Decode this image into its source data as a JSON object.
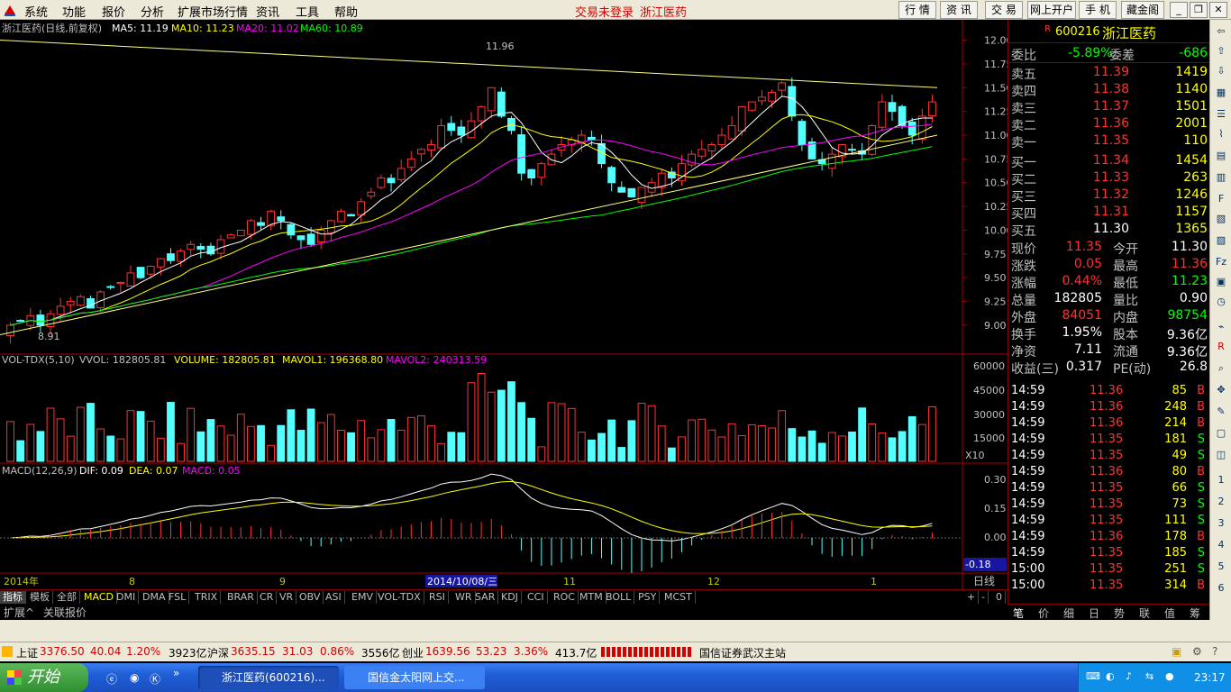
{
  "menu": {
    "items": [
      "系统",
      "功能",
      "报价",
      "分析",
      "扩展市场行情",
      "资讯",
      "工具",
      "帮助"
    ],
    "notice1": "交易未登录",
    "notice2": "浙江医药",
    "right": [
      "行 情",
      "资 讯",
      "交 易",
      "网上开户",
      "手 机",
      "藏金阁"
    ]
  },
  "chart": {
    "title": "浙江医药(日线,前复权)",
    "ma5": "MA5: 11.19",
    "ma10": "MA10: 11.23",
    "ma20": "MA20: 11.02",
    "ma60": "MA60: 10.89",
    "high_mark": "11.96",
    "low_mark": "8.91",
    "price_ticks": [
      "12.00",
      "11.75",
      "11.50",
      "11.25",
      "11.00",
      "10.75",
      "10.50",
      "10.25",
      "10.00",
      "9.75",
      "9.50",
      "9.25",
      "9.00"
    ],
    "vol_title": "VOL-TDX(5,10)",
    "vvol": "VVOL: 182805.81",
    "volume": "VOLUME: 182805.81",
    "mavol1": "MAVOL1: 196368.80",
    "mavol2": "MAVOL2: 240313.59",
    "vol_ticks": [
      "60000",
      "45000",
      "30000",
      "15000"
    ],
    "vol_unit": "X10",
    "macd_title": "MACD(12,26,9)",
    "dif": "DIF: 0.09",
    "dea": "DEA: 0.07",
    "macd": "MACD: 0.05",
    "macd_ticks": [
      "0.30",
      "0.15",
      "0.00"
    ],
    "macd_cursor": "-0.18",
    "date_labels": [
      "2014年",
      "8",
      "9",
      "2014/10/08/三",
      "11",
      "12",
      "1"
    ],
    "period": "日线"
  },
  "chart_data": {
    "type": "candlestick",
    "series_colors": {
      "up": "#ff3232",
      "down": "#54ffff",
      "ma5": "#ffffff",
      "ma10": "#ffff00",
      "ma20": "#ff00ff",
      "ma60": "#00ff00"
    },
    "price_range": [
      8.91,
      11.96
    ],
    "ylim": [
      8.8,
      12.1
    ],
    "closes": [
      9.0,
      9.05,
      9.1,
      9.0,
      9.12,
      9.2,
      9.25,
      9.3,
      9.18,
      9.35,
      9.4,
      9.45,
      9.55,
      9.5,
      9.62,
      9.7,
      9.68,
      9.78,
      9.85,
      9.8,
      9.75,
      9.9,
      9.95,
      10.0,
      10.1,
      10.05,
      10.2,
      10.1,
      9.95,
      9.9,
      9.85,
      10.0,
      10.1,
      10.2,
      10.15,
      10.3,
      10.4,
      10.55,
      10.5,
      10.65,
      10.75,
      10.85,
      10.9,
      11.1,
      11.05,
      11.0,
      11.15,
      11.3,
      11.5,
      11.2,
      11.05,
      10.6,
      10.55,
      10.7,
      10.8,
      10.9,
      10.95,
      11.0,
      10.95,
      10.7,
      10.5,
      10.4,
      10.35,
      10.45,
      10.5,
      10.6,
      10.55,
      10.7,
      10.8,
      10.85,
      10.9,
      11.0,
      11.1,
      11.3,
      11.35,
      11.4,
      11.45,
      11.55,
      11.2,
      10.9,
      10.75,
      10.7,
      10.8,
      10.9,
      10.85,
      10.8,
      11.1,
      11.35,
      11.25,
      11.1,
      11.0,
      11.2,
      11.35
    ],
    "vol_range": [
      0,
      60000
    ],
    "macd_range": [
      -0.25,
      0.35
    ]
  },
  "quote": {
    "market": "R",
    "code": "600216",
    "name": "浙江医药",
    "wei_bi_label": "委比",
    "wei_bi": "-5.89%",
    "wei_cha_label": "委差",
    "wei_cha": "-686",
    "asks": [
      {
        "label": "卖五",
        "price": "11.39",
        "vol": "1419"
      },
      {
        "label": "卖四",
        "price": "11.38",
        "vol": "1140"
      },
      {
        "label": "卖三",
        "price": "11.37",
        "vol": "1501"
      },
      {
        "label": "卖二",
        "price": "11.36",
        "vol": "2001"
      },
      {
        "label": "卖一",
        "price": "11.35",
        "vol": "110"
      }
    ],
    "bids": [
      {
        "label": "买一",
        "price": "11.34",
        "vol": "1454"
      },
      {
        "label": "买二",
        "price": "11.33",
        "vol": "263"
      },
      {
        "label": "买三",
        "price": "11.32",
        "vol": "1246"
      },
      {
        "label": "买四",
        "price": "11.31",
        "vol": "1157"
      },
      {
        "label": "买五",
        "price": "11.30",
        "vol": "1365"
      }
    ],
    "stats": [
      [
        "现价",
        "11.35",
        "今开",
        "11.30"
      ],
      [
        "涨跌",
        "0.05",
        "最高",
        "11.36"
      ],
      [
        "涨幅",
        "0.44%",
        "最低",
        "11.23"
      ],
      [
        "总量",
        "182805",
        "量比",
        "0.90"
      ],
      [
        "外盘",
        "84051",
        "内盘",
        "98754"
      ],
      [
        "换手",
        "1.95%",
        "股本",
        "9.36亿"
      ],
      [
        "净资",
        "7.11",
        "流通",
        "9.36亿"
      ],
      [
        "收益(三)",
        "0.317",
        "PE(动)",
        "26.8"
      ]
    ],
    "ticks": [
      [
        "14:59",
        "11.36",
        "85",
        "B"
      ],
      [
        "14:59",
        "11.36",
        "248",
        "B"
      ],
      [
        "14:59",
        "11.36",
        "214",
        "B"
      ],
      [
        "14:59",
        "11.35",
        "181",
        "S"
      ],
      [
        "14:59",
        "11.35",
        "49",
        "S"
      ],
      [
        "14:59",
        "11.36",
        "80",
        "B"
      ],
      [
        "14:59",
        "11.35",
        "66",
        "S"
      ],
      [
        "14:59",
        "11.35",
        "73",
        "S"
      ],
      [
        "14:59",
        "11.35",
        "111",
        "S"
      ],
      [
        "14:59",
        "11.36",
        "178",
        "B"
      ],
      [
        "14:59",
        "11.35",
        "185",
        "S"
      ],
      [
        "15:00",
        "11.35",
        "251",
        "S"
      ],
      [
        "15:00",
        "11.35",
        "314",
        "B"
      ]
    ],
    "bottom_tabs": [
      "笔",
      "价",
      "细",
      "日",
      "势",
      "联",
      "值",
      "筹"
    ]
  },
  "indicator_tabs": [
    "指标",
    "模板",
    "全部",
    "MACD",
    "DMI",
    "DMA",
    "FSL",
    "TRIX",
    "BRAR",
    "CR",
    "VR",
    "OBV",
    "ASI",
    "EMV",
    "VOL-TDX",
    "RSI",
    "WR",
    "SAR",
    "KDJ",
    "CCI",
    "ROC",
    "MTM",
    "BOLL",
    "PSY",
    "MCST"
  ],
  "zoom": [
    "+",
    "-",
    "0"
  ],
  "ext": {
    "a": "扩展^",
    "b": "关联报价"
  },
  "status": {
    "sh_label": "上证",
    "sh": "3376.50",
    "sh_chg": "40.04",
    "sh_pct": "1.20%",
    "sh_amt": "3923亿",
    "hs_label": "沪深",
    "hs": "3635.15",
    "hs_chg": "31.03",
    "hs_pct": "0.86%",
    "hs_amt": "3556亿",
    "cy_label": "创业",
    "cy": "1639.56",
    "cy_chg": "53.23",
    "cy_pct": "3.36%",
    "cy_amt": "413.7亿",
    "station": "国信证券武汉主站"
  },
  "taskbar": {
    "start": "开始",
    "task1": "浙江医药(600216)...",
    "task2": "国信金太阳网上交...",
    "clock": "23:17"
  }
}
